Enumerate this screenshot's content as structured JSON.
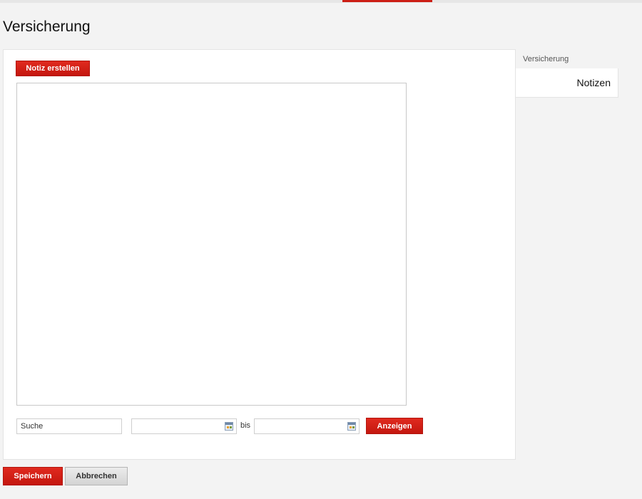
{
  "page": {
    "title": "Versicherung"
  },
  "main": {
    "create_note_label": "Notiz erstellen",
    "search": {
      "value": "Suche"
    },
    "date_from": {
      "value": "",
      "icon": "calendar-icon"
    },
    "date_separator": "bis",
    "date_to": {
      "value": "",
      "icon": "calendar-icon"
    },
    "show_label": "Anzeigen"
  },
  "sidebar": {
    "section_label": "Versicherung",
    "active_tab": "Notizen"
  },
  "footer": {
    "save_label": "Speichern",
    "cancel_label": "Abbrechen"
  },
  "colors": {
    "accent": "#cc1f16",
    "background": "#f3f3f3",
    "panel": "#ffffff"
  }
}
